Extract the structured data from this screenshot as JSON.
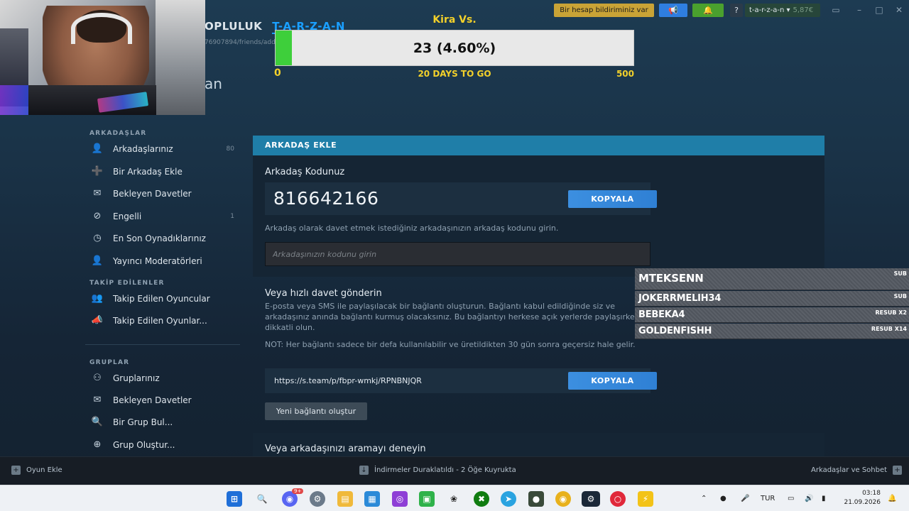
{
  "titlebar": {
    "warning_button": "Bir hesap bildiriminiz var",
    "announce_icon": "megaphone-icon",
    "notifications_icon": "bell-icon",
    "help_label": "?",
    "username": "t-a-r-z-a-n",
    "balance": "5,87€",
    "accent_color": "#1a9fff"
  },
  "nav": {
    "community_fragment": "OPLULUK",
    "profile_tab": "T-A-R-Z-A-N",
    "url_fragment": "76907894/friends/add"
  },
  "page_heading_fragment": "an",
  "goal_overlay": {
    "title": "Kira Vs.",
    "progress_text": "23 (4.60%)",
    "progress_fraction": 0.046,
    "min_label": "0",
    "days_label": "20 DAYS TO GO",
    "max_label": "500"
  },
  "sidebar": {
    "friends_title": "ARKADAŞLAR",
    "friends_items": [
      {
        "label": "Arkadaşlarınız",
        "count": "80",
        "icon": "user-icon"
      },
      {
        "label": "Bir Arkadaş Ekle",
        "count": "",
        "icon": "user-add-icon"
      },
      {
        "label": "Bekleyen Davetler",
        "count": "",
        "icon": "envelope-icon"
      },
      {
        "label": "Engelli",
        "count": "1",
        "icon": "blocked-icon"
      },
      {
        "label": "En Son Oynadıklarınız",
        "count": "",
        "icon": "clock-icon"
      },
      {
        "label": "Yayıncı Moderatörleri",
        "count": "",
        "icon": "user-icon"
      }
    ],
    "following_title": "TAKİP EDİLENLER",
    "following_items": [
      {
        "label": "Takip Edilen Oyuncular",
        "icon": "followed-users-icon"
      },
      {
        "label": "Takip Edilen Oyunlar...",
        "icon": "followed-games-icon"
      }
    ],
    "groups_title": "GRUPLAR",
    "groups_items": [
      {
        "label": "Gruplarınız",
        "icon": "group-icon"
      },
      {
        "label": "Bekleyen Davetler",
        "icon": "envelope-icon"
      },
      {
        "label": "Bir Grup Bul...",
        "icon": "search-icon"
      },
      {
        "label": "Grup Oluştur...",
        "icon": "plus-circle-icon"
      }
    ]
  },
  "main": {
    "header": "ARKADAŞ EKLE",
    "friend_code_label": "Arkadaş Kodunuz",
    "friend_code": "816642166",
    "copy_label": "KOPYALA",
    "code_hint": "Arkadaş olarak davet etmek istediğiniz arkadaşınızın arkadaş kodunu girin.",
    "code_input_placeholder": "Arkadaşınızın kodunu girin",
    "quick_invite_title": "Veya hızlı davet gönderin",
    "quick_invite_text": "E-posta veya SMS ile paylaşılacak bir bağlantı oluşturun. Bağlantı kabul edildiğinde siz ve arkadaşınız anında bağlantı kurmuş olacaksınız. Bu bağlantıyı herkese açık yerlerde paylaşırken dikkatli olun.",
    "note_text": "NOT: Her bağlantı sadece bir defa kullanılabilir ve üretildikten 30 gün sonra geçersiz hale gelir.",
    "invite_link": "https://s.team/p/fbpr-wmkj/RPNBNJQR",
    "copy_label_2": "KOPYALA",
    "new_link_label": "Yeni bağlantı oluştur",
    "search_title": "Veya arkadaşınızı aramayı deneyin"
  },
  "sub_ticker": [
    {
      "name": "MTEKSENN",
      "tag": "SUB"
    },
    {
      "name": "JOKERRMELIH34",
      "tag": "SUB"
    },
    {
      "name": "BEBEKA4",
      "tag": "RESUB X2"
    },
    {
      "name": "GOLDENFISHH",
      "tag": "RESUB X14"
    }
  ],
  "bottombar": {
    "add_game": "Oyun Ekle",
    "downloads": "İndirmeler Duraklatıldı - 2 Öğe Kuyrukta",
    "friends_chat": "Arkadaşlar ve Sohbet"
  },
  "taskbar": {
    "language": "TUR",
    "time": "03:18",
    "date": "21.09.2026",
    "discord_badge": "9+"
  }
}
